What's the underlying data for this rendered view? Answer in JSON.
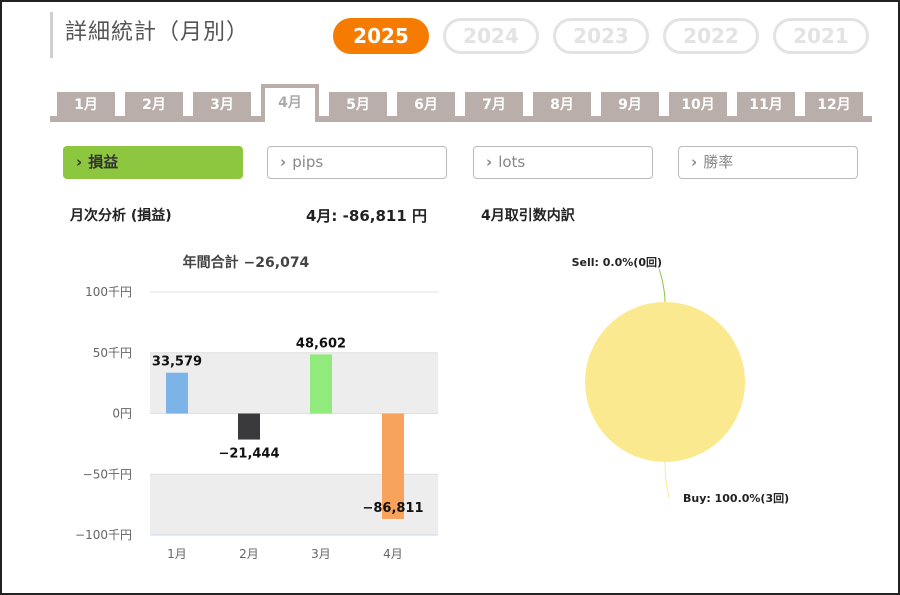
{
  "title": "詳細統計（月別）",
  "years": [
    {
      "label": "2025",
      "active": true
    },
    {
      "label": "2024",
      "active": false
    },
    {
      "label": "2023",
      "active": false
    },
    {
      "label": "2022",
      "active": false
    },
    {
      "label": "2021",
      "active": false
    }
  ],
  "months": [
    {
      "label": "1月",
      "active": false
    },
    {
      "label": "2月",
      "active": false
    },
    {
      "label": "3月",
      "active": false
    },
    {
      "label": "4月",
      "active": true
    },
    {
      "label": "5月",
      "active": false
    },
    {
      "label": "6月",
      "active": false
    },
    {
      "label": "7月",
      "active": false
    },
    {
      "label": "8月",
      "active": false
    },
    {
      "label": "9月",
      "active": false
    },
    {
      "label": "10月",
      "active": false
    },
    {
      "label": "11月",
      "active": false
    },
    {
      "label": "12月",
      "active": false
    }
  ],
  "metrics": [
    {
      "label": "損益",
      "active": true
    },
    {
      "label": "pips",
      "active": false
    },
    {
      "label": "lots",
      "active": false
    },
    {
      "label": "勝率",
      "active": false
    }
  ],
  "chevron_icon": "›",
  "summary": {
    "section_title": "月次分析 (損益)",
    "month_total": "4月:  -86,811 円",
    "breakdown_title": "4月取引数内訳"
  },
  "colors": {
    "accent_orange": "#f57c00",
    "metric_green": "#8dc63f",
    "tab_gray": "#b9aeaa",
    "pie_yellow": "#fbe98f"
  },
  "chart_data": [
    {
      "type": "bar",
      "title": "年間合計 −26,074",
      "categories": [
        "1月",
        "2月",
        "3月",
        "4月"
      ],
      "values": [
        33579,
        -21444,
        48602,
        -86811
      ],
      "value_labels": [
        "33,579",
        "−21,444",
        "48,602",
        "−86,811"
      ],
      "colors": [
        "#7cb4e8",
        "#3a3a3d",
        "#90eb7c",
        "#f7a35c"
      ],
      "ylim": [
        -100000,
        100000
      ],
      "yticks": [
        {
          "value": 100000,
          "label": "100千円"
        },
        {
          "value": 50000,
          "label": "50千円"
        },
        {
          "value": 0,
          "label": "0円"
        },
        {
          "value": -50000,
          "label": "−50千円"
        },
        {
          "value": -100000,
          "label": "−100千円"
        }
      ],
      "grid": true
    },
    {
      "type": "pie",
      "slices": [
        {
          "label": "Sell: 0.0%(0回)",
          "value": 0,
          "color": "#8dc63f"
        },
        {
          "label": "Buy: 100.0%(3回)",
          "value": 100,
          "color": "#fbe98f"
        }
      ]
    }
  ]
}
